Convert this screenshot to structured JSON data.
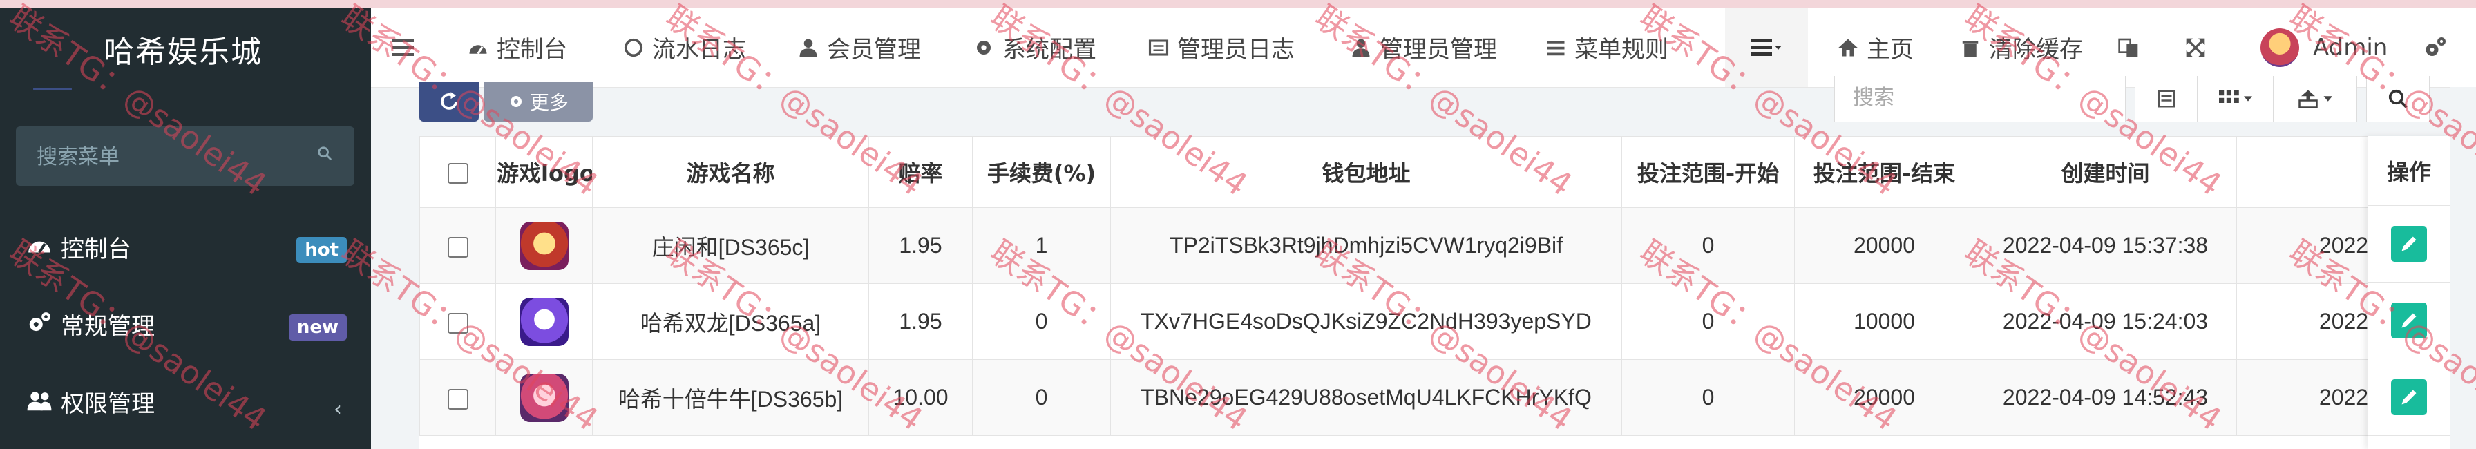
{
  "app": {
    "title": "哈希娱乐城"
  },
  "sidebar": {
    "search_placeholder": "搜索菜单",
    "items": [
      {
        "label": "控制台",
        "badge": "hot",
        "icon": "dashboard-icon"
      },
      {
        "label": "常规管理",
        "badge": "new",
        "icon": "cogs-icon"
      },
      {
        "label": "权限管理",
        "icon": "users-icon",
        "chevron": "‹"
      }
    ]
  },
  "navbar": {
    "items": [
      {
        "label": "控制台",
        "icon": "dashboard-icon"
      },
      {
        "label": "流水日志",
        "icon": "circle-icon"
      },
      {
        "label": "会员管理",
        "icon": "user-icon"
      },
      {
        "label": "系统配置",
        "icon": "gear-icon"
      },
      {
        "label": "管理员日志",
        "icon": "list-alt-icon"
      },
      {
        "label": "管理员管理",
        "icon": "user-icon"
      },
      {
        "label": "菜单规则",
        "icon": "bars-icon"
      }
    ],
    "right": [
      {
        "label": "主页",
        "icon": "home-icon"
      },
      {
        "label": "清除缓存",
        "icon": "trash-icon"
      }
    ],
    "user": "Admin"
  },
  "toolbar": {
    "more_label": "更多",
    "search_placeholder": "搜索"
  },
  "table": {
    "columns": [
      "游戏logo",
      "游戏名称",
      "赔率",
      "手续费(%)",
      "钱包地址",
      "投注范围-开始",
      "投注范围-结束",
      "创建时间",
      "",
      "操作"
    ],
    "rows": [
      {
        "name": "庄闲和[DS365c]",
        "odds": "1.95",
        "fee": "1",
        "wallet": "TP2iTSBk3Rt9jhDmhjzi5CVW1ryq2i9Bif",
        "min": "0",
        "max": "20000",
        "created": "2022-04-09 15:37:38",
        "extra": "2022",
        "logo_color": "#c0392b"
      },
      {
        "name": "哈希双龙[DS365a]",
        "odds": "1.95",
        "fee": "0",
        "wallet": "TXv7HGE4soDsQJKsiZ9ZC2NdH393yepSYD",
        "min": "0",
        "max": "10000",
        "created": "2022-04-09 15:24:03",
        "extra": "2022",
        "logo_color": "#6a3bc7"
      },
      {
        "name": "哈希十倍牛牛[DS365b]",
        "odds": "10.00",
        "fee": "0",
        "wallet": "TBNe29oEG429U88osetMqU4LKFCKHrYKfQ",
        "min": "0",
        "max": "20000",
        "created": "2022-04-09 14:52:43",
        "extra": "2022",
        "logo_color": "#d24a78"
      }
    ]
  },
  "watermark": "联系TG：@saolei44"
}
